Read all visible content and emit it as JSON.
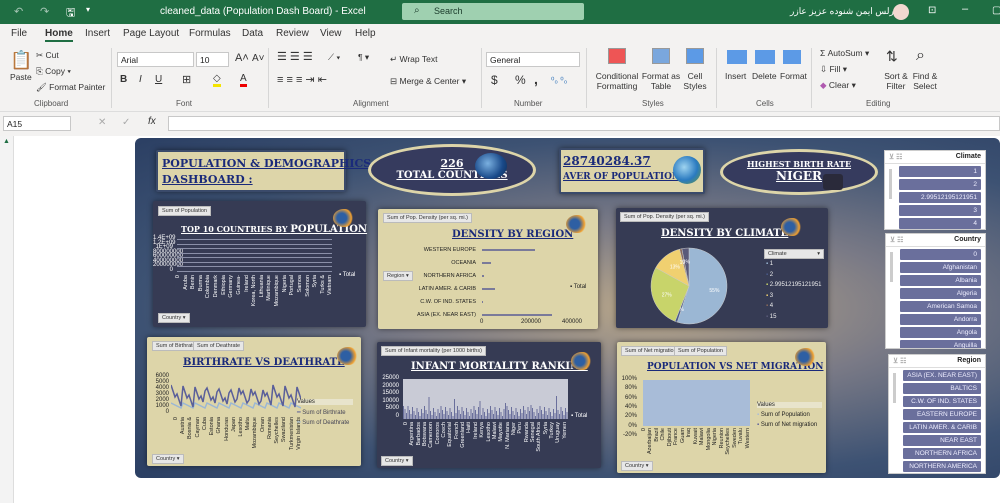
{
  "window": {
    "title": "cleaned_data (Population Dash Board)  -  Excel",
    "search": "Search",
    "user": "كيرلس ايمن شنوده عزيز عازر"
  },
  "menu": [
    "File",
    "Home",
    "Insert",
    "Page Layout",
    "Formulas",
    "Data",
    "Review",
    "View",
    "Help"
  ],
  "ribbon": {
    "clipboard": {
      "paste": "Paste",
      "cut": "Cut",
      "copy": "Copy",
      "format_painter": "Format Painter",
      "label": "Clipboard"
    },
    "font": {
      "name": "Arial",
      "size": "10",
      "bold": "B",
      "italic": "I",
      "underline": "U",
      "label": "Font"
    },
    "alignment": {
      "wrap": "Wrap Text",
      "merge": "Merge & Center",
      "label": "Alignment"
    },
    "number": {
      "format": "General",
      "dollar": "$",
      "percent": "%",
      "comma": ",",
      "label": "Number"
    },
    "styles": {
      "conditional": "Conditional Formatting",
      "format_table": "Format as Table",
      "cell_styles": "Cell Styles",
      "label": "Styles"
    },
    "cells": {
      "insert": "Insert",
      "delete": "Delete",
      "format": "Format",
      "label": "Cells"
    },
    "editing": {
      "autosum": "AutoSum",
      "fill": "Fill",
      "clear": "Clear",
      "sort": "Sort & Filter",
      "find": "Find & Select",
      "label": "Editing"
    }
  },
  "formula": {
    "name_box": "A15",
    "value": ""
  },
  "dashboard": {
    "title_line1": "POPULATION & DEMOGRAPHICS",
    "title_line2": "DASHBOARD :",
    "kpi_countries": {
      "value": "226",
      "label": "TOTAL COUNTRIES"
    },
    "kpi_population": {
      "value": "28740284.37",
      "label": "AVER OF POPULATION"
    },
    "kpi_birth": {
      "label": "HIGHEST BIRTH RATE",
      "value": "NIGER"
    },
    "top10": {
      "field": "Sum of Population",
      "title1": "TOP 10 COUNTRIES BY ",
      "title2": "POPULATION",
      "filter": "Country",
      "legend": "Total",
      "yticks": [
        "1.4E+09",
        "1.2E+09",
        "1E+09",
        "800000000",
        "600000000",
        "400000000",
        "200000000",
        "0"
      ],
      "xlabels": [
        "0",
        "Aruba",
        "Benin",
        "Burma",
        "Colombia",
        "Denmark",
        "Ethiopia",
        "Germany",
        "Guinea-",
        "Ireland",
        "Korea, North",
        "Lithuania",
        "Martinique",
        "Mozambique",
        "Nigeria",
        "Portugal",
        "Samoa",
        "Solomon",
        "Syria",
        "Turks &",
        "Vietnam"
      ]
    },
    "density_region": {
      "field": "Sum of Pop. Density (per sq. mi.)",
      "title": "DENSITY BY REGION",
      "filter": "Region",
      "legend": "Total",
      "categories": [
        "WESTERN EUROPE",
        "OCEANIA",
        "NORTHERN AFRICA",
        "LATIN AMER. & CARIB",
        "C.W. OF IND. STATES",
        "ASIA (EX. NEAR EAST)"
      ],
      "values": [
        260000,
        45000,
        8000,
        62000,
        3000,
        340000
      ],
      "xticks": [
        "0",
        "200000",
        "400000"
      ]
    },
    "density_climate": {
      "field": "Sum of Pop. Density (per sq. mi.)",
      "title": "DENSITY BY CLIMATE",
      "filter": "Climate",
      "slices": [
        {
          "label": "1",
          "pct": 55,
          "color": "#9bb7d4"
        },
        {
          "label": "2",
          "pct": 1,
          "color": "#4a5a8a"
        },
        {
          "label": "2.99512195121951",
          "pct": 27,
          "color": "#c8d46a"
        },
        {
          "label": "3",
          "pct": 13,
          "color": "#f0d070"
        },
        {
          "label": "4",
          "pct": 1,
          "color": "#8a6a5a"
        },
        {
          "label": "15",
          "pct": 3,
          "color": "#5a5a7a"
        }
      ]
    },
    "birth_death": {
      "fields": [
        "Sum of Birthrate",
        "Sum of Deathrate"
      ],
      "title": "BIRTHRATE VS DEATHRATE",
      "filter": "Country",
      "legend_title": "Values",
      "legend": [
        "Sum of Birthrate",
        "Sum of Deathrate"
      ],
      "yticks": [
        "6000",
        "5000",
        "4000",
        "3000",
        "2000",
        "1000",
        "0"
      ],
      "xlabels": [
        "0",
        "Austria",
        "Bosnia &",
        "Cayman",
        "Cuba",
        "Estonia",
        "Ghana",
        "Honduras",
        "Japan",
        "Lesotho",
        "Malta",
        "Mozambique",
        "Oman",
        "Romania",
        "Seychelles",
        "Swaziland",
        "Turkmenistan",
        "Virgin Islands"
      ]
    },
    "infant": {
      "field": "Sum of Infant mortality (per 1000 births)",
      "title": "INFANT MORTALITY RANKING",
      "filter": "Country",
      "legend": "Total",
      "yticks": [
        "25000",
        "20000",
        "15000",
        "10000",
        "5000",
        "0"
      ],
      "xlabels": [
        "0",
        "Argentina",
        "Barbados",
        "Botswana",
        "Cameroon",
        "Comoros",
        "Czech",
        "Equatorial",
        "French",
        "Greenland",
        "Haiti",
        "Ireland",
        "Kenya",
        "Lesotho",
        "Malawi",
        "Mayotte",
        "N. Mariana",
        "Niger",
        "Peru",
        "Rwanda",
        "Senegal",
        "South Africa",
        "Syria",
        "Turkey",
        "Uruguay",
        "Yemen"
      ]
    },
    "migration": {
      "fields": [
        "Sum of Net migration",
        "Sum of Population"
      ],
      "title": "POPULATION VS NET MIGRATION",
      "filter": "Country",
      "legend_title": "Values",
      "legend": [
        "Sum of Population",
        "Sum of Net migration"
      ],
      "yticks": [
        "100%",
        "80%",
        "60%",
        "40%",
        "20%",
        "0%",
        "-20%"
      ],
      "xlabels": [
        "0",
        "Azerbaijan",
        "Brazil",
        "Chile",
        "Djibouti",
        "France",
        "Guam",
        "Iraq",
        "Kuwait",
        "Malawi",
        "Mongolia",
        "Nigeria",
        "Reunion",
        "Seychelles",
        "Sweden",
        "Tuvalu",
        "Western"
      ]
    }
  },
  "slicers": [
    {
      "title": "Climate",
      "items": [
        "1",
        "2",
        "2.99512195121951",
        "3",
        "4"
      ]
    },
    {
      "title": "Country",
      "items": [
        "0",
        "Afghanistan",
        "Albania",
        "Algeria",
        "American Samoa",
        "Andorra",
        "Angola",
        "Anguilla"
      ]
    },
    {
      "title": "Region",
      "items": [
        "ASIA (EX. NEAR EAST)",
        "BALTICS",
        "C.W. OF IND. STATES",
        "EASTERN EUROPE",
        "LATIN AMER. & CARIB",
        "NEAR EAST",
        "NORTHERN AFRICA",
        "NORTHERN AMERICA"
      ]
    }
  ]
}
